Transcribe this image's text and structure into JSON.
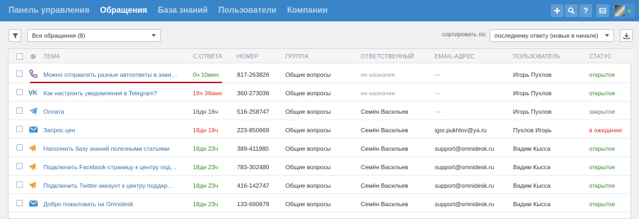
{
  "nav": {
    "items": [
      "Панель управления",
      "Обращения",
      "База знаний",
      "Пользователи",
      "Компании"
    ],
    "active": "Обращения"
  },
  "topbar_icons": [
    "plus-icon",
    "search-icon",
    "help-icon",
    "messages-icon"
  ],
  "toolbar": {
    "filter_value": "Все обращения (8)",
    "sort_label": "сортировать по:",
    "sort_value": "последнему ответу (новые в начале)"
  },
  "table": {
    "headers": {
      "subject": "ТЕМА",
      "since": "С ОТВЕТА",
      "number": "НОМЕР",
      "group": "ГРУППА",
      "assignee": "ОТВЕТСТВЕННЫЙ",
      "email": "EMAIL-АДРЕС",
      "user": "ПОЛЬЗОВАТЕЛЬ",
      "status": "СТАТУС"
    },
    "rows": [
      {
        "channel": "phone",
        "subject": "Можно отправлять разные автоответы в зави…",
        "since": "0ч 10мин",
        "since_color": "green",
        "number": "817-263826",
        "group": "Общие вопросы",
        "assignee": "не назначен",
        "email": "—",
        "user": "Игорь Пухлов",
        "status": "открытое",
        "status_color": "green"
      },
      {
        "channel": "vk",
        "subject": "Как настроить уведомления в Telegram?",
        "since": "19ч 36мин",
        "since_color": "red",
        "number": "360-273036",
        "group": "Общие вопросы",
        "assignee": "не назначен",
        "email": "—",
        "user": "Игорь Пухлов",
        "status": "открытое",
        "status_color": "green"
      },
      {
        "channel": "telegram",
        "subject": "Оплата",
        "since": "16дн 16ч",
        "since_color": "dark",
        "number": "516-258747",
        "group": "Общие вопросы",
        "assignee": "Семён Васильев",
        "email": "—",
        "user": "Игорь Пухлов",
        "status": "закрытое",
        "status_color": "gray"
      },
      {
        "channel": "email",
        "subject": "Запрос цен",
        "since": "18дн 19ч",
        "since_color": "red",
        "number": "223-850669",
        "group": "Общие вопросы",
        "assignee": "Семён Васильев",
        "email": "igor.pukhlov@ya.ru",
        "user": "Пухлов Игорь",
        "status": "в ожидании",
        "status_color": "red"
      },
      {
        "channel": "megaphone",
        "subject": "Наполнить базу знаний полезными статьями",
        "since": "18дн 23ч",
        "since_color": "green",
        "number": "389-411980",
        "group": "Общие вопросы",
        "assignee": "Семён Васильев",
        "email": "support@omnidesk.ru",
        "user": "Вадим Кысса",
        "status": "открытое",
        "status_color": "green"
      },
      {
        "channel": "megaphone",
        "subject": "Подключить Facebook-страницу к центру под…",
        "since": "18дн 23ч",
        "since_color": "green",
        "number": "783-302480",
        "group": "Общие вопросы",
        "assignee": "Семён Васильев",
        "email": "support@omnidesk.ru",
        "user": "Вадим Кысса",
        "status": "открытое",
        "status_color": "green"
      },
      {
        "channel": "megaphone",
        "subject": "Подключить Twitter-аккаунт к центру поддер…",
        "since": "18дн 23ч",
        "since_color": "green",
        "number": "416-142747",
        "group": "Общие вопросы",
        "assignee": "Семён Васильев",
        "email": "support@omnidesk.ru",
        "user": "Вадим Кысса",
        "status": "открытое",
        "status_color": "green"
      },
      {
        "channel": "email",
        "subject": "Добро пожаловать на Omnidesk",
        "since": "18дн 23ч",
        "since_color": "green",
        "number": "133-690679",
        "group": "Общие вопросы",
        "assignee": "Семён Васильев",
        "email": "support@omnidesk.ru",
        "user": "Вадим Кысса",
        "status": "открытое",
        "status_color": "green"
      }
    ]
  },
  "colors": {
    "topbar": "#3a85c9",
    "link": "#3a6fa8",
    "green": "#2e8b1e",
    "red": "#d93025",
    "highlight_underline": "#c8102e"
  }
}
